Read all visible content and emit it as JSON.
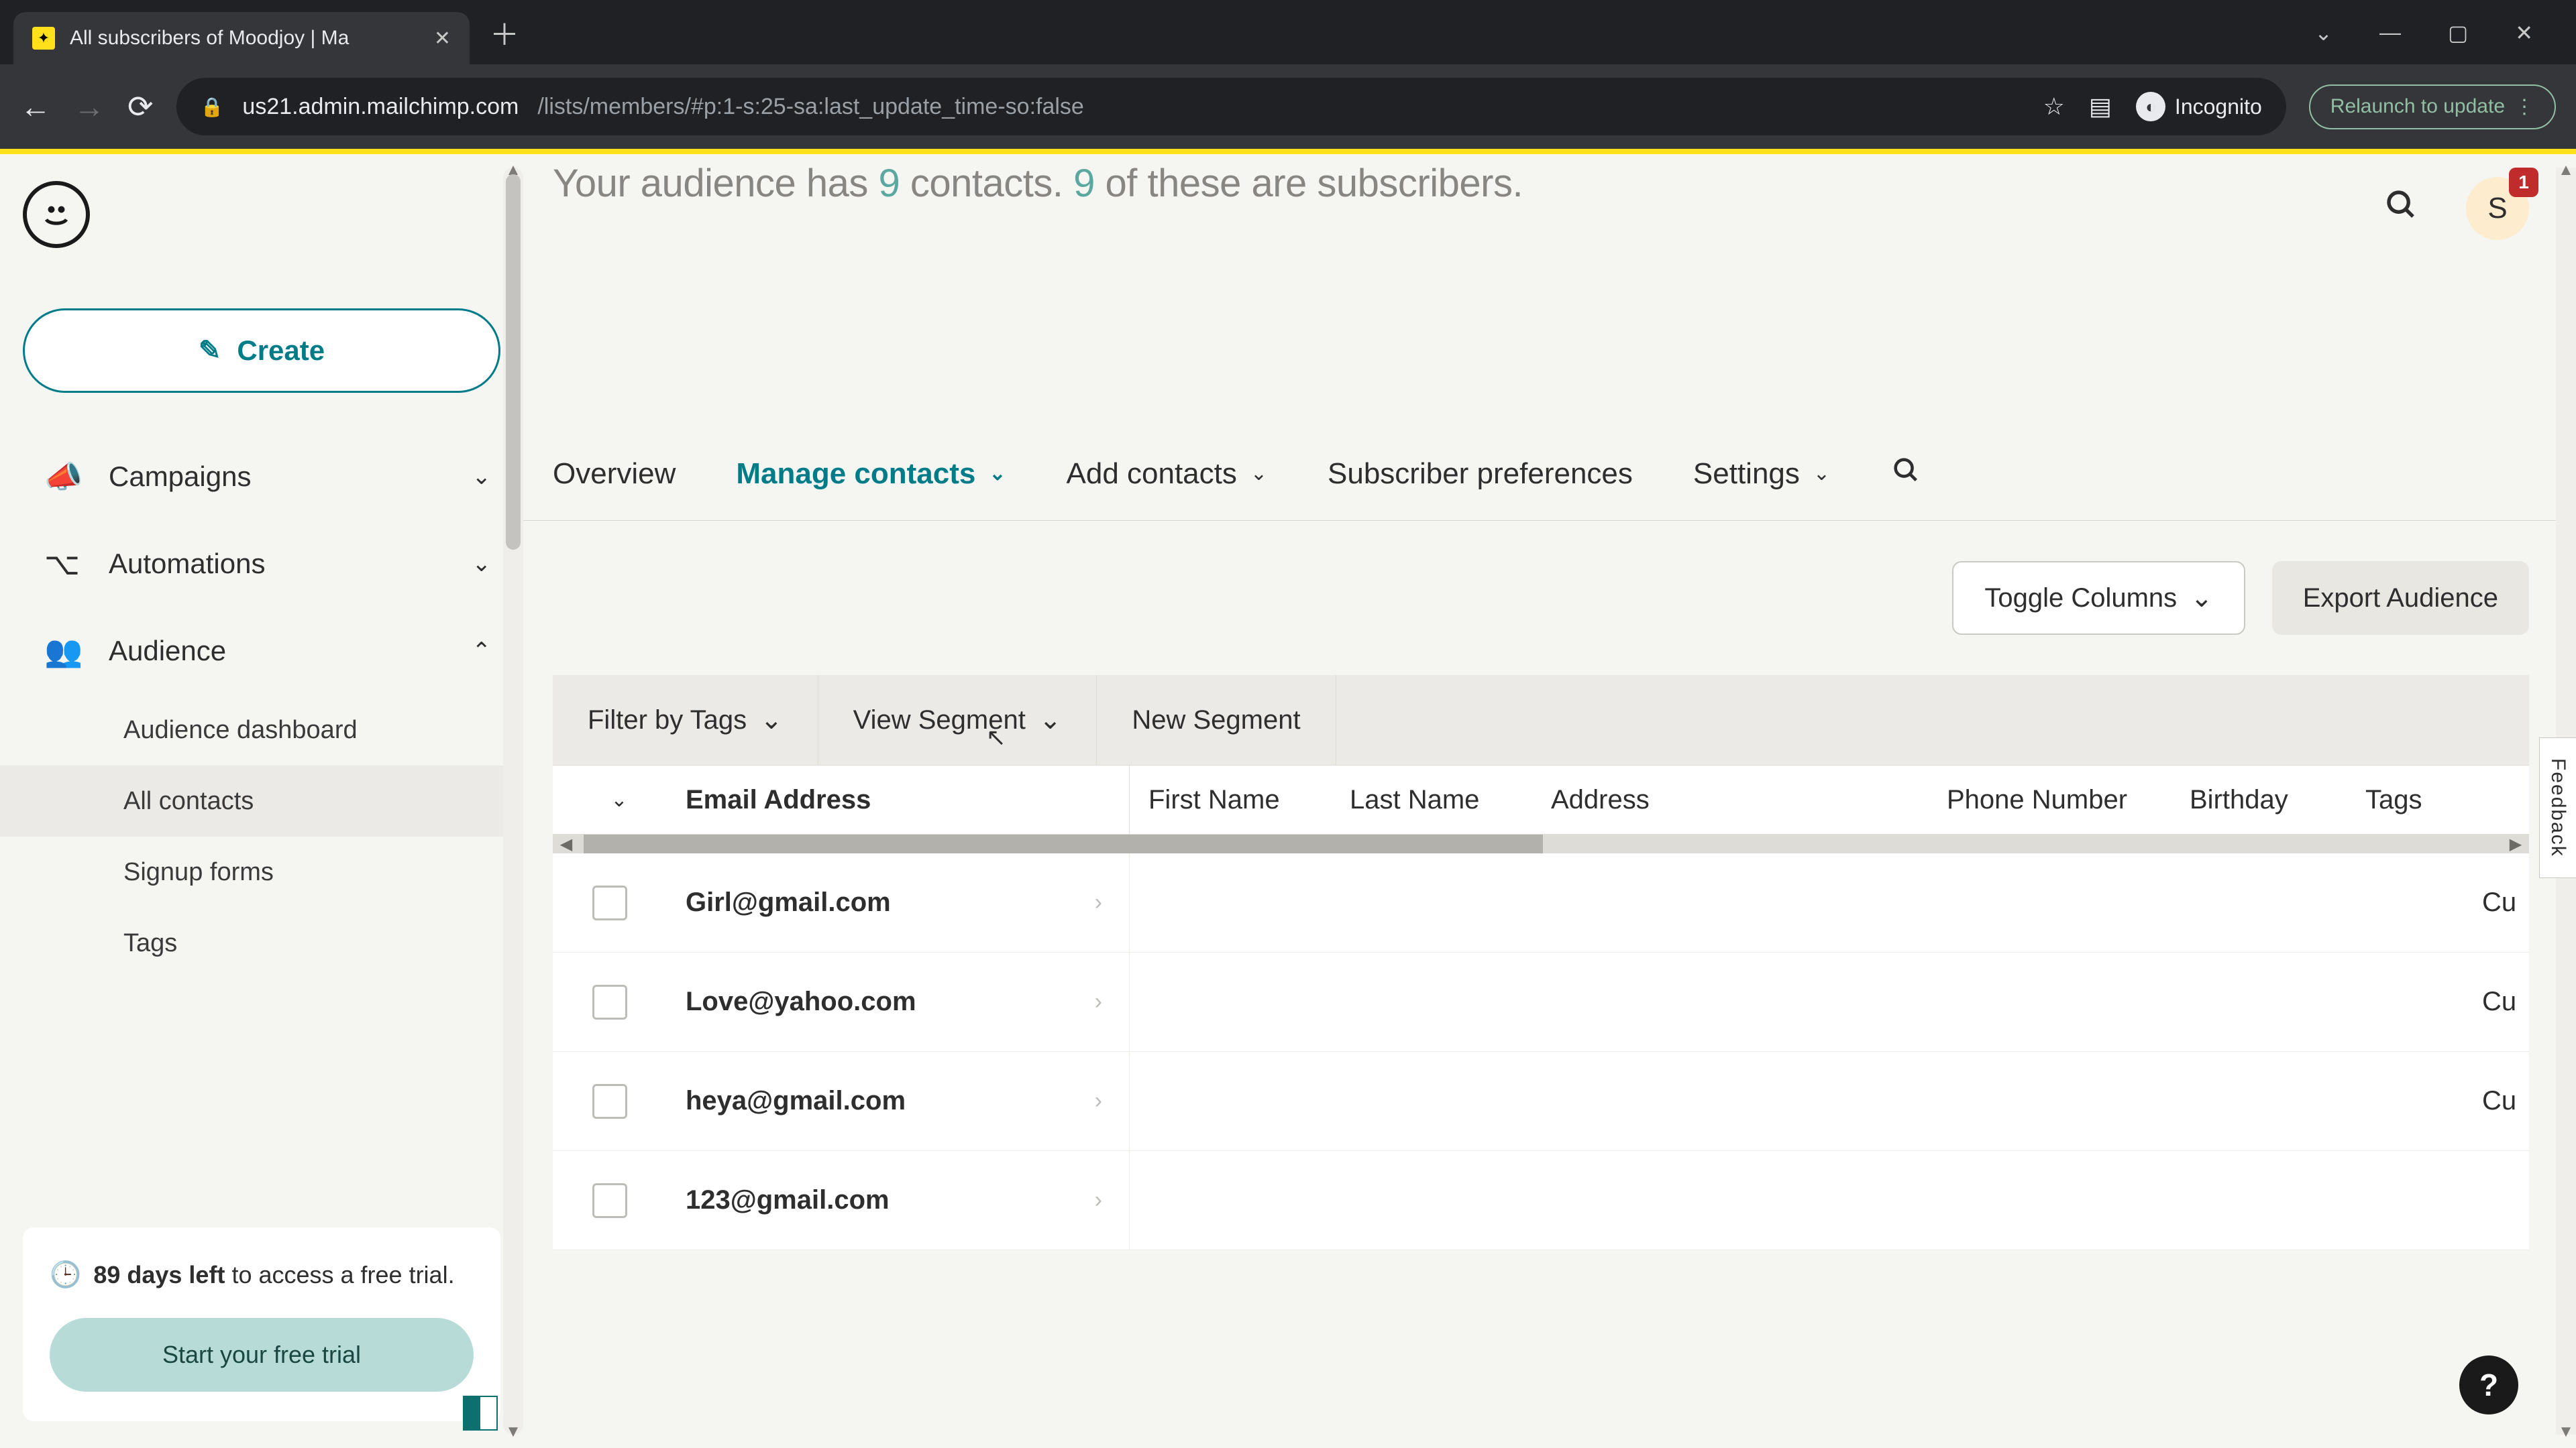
{
  "browser": {
    "tab_title": "All subscribers of Moodjoy | Ma",
    "url_host": "us21.admin.mailchimp.com",
    "url_path": "/lists/members/#p:1-s:25-sa:last_update_time-so:false",
    "incognito_label": "Incognito",
    "relaunch_label": "Relaunch to update"
  },
  "sidebar": {
    "create_label": "Create",
    "items": [
      {
        "label": "Campaigns"
      },
      {
        "label": "Automations"
      },
      {
        "label": "Audience"
      }
    ],
    "audience_sub": [
      {
        "label": "Audience dashboard"
      },
      {
        "label": "All contacts"
      },
      {
        "label": "Signup forms"
      },
      {
        "label": "Tags"
      }
    ],
    "trial_days": "89 days left",
    "trial_rest": " to access a free trial.",
    "trial_btn": "Start your free trial"
  },
  "header": {
    "line_prefix": "Your audience has ",
    "contacts_count": "9",
    "line_mid": " contacts. ",
    "subs_count": "9",
    "line_suffix": " of these are subscribers."
  },
  "tabs": {
    "overview": "Overview",
    "manage": "Manage contacts",
    "add": "Add contacts",
    "prefs": "Subscriber preferences",
    "settings": "Settings"
  },
  "actions": {
    "toggle_cols": "Toggle Columns",
    "export": "Export Audience"
  },
  "filters": {
    "by_tags": "Filter by Tags",
    "view_segment": "View Segment",
    "new_segment": "New Segment"
  },
  "table": {
    "headers": {
      "email": "Email Address",
      "first": "First Name",
      "last": "Last Name",
      "address": "Address",
      "phone": "Phone Number",
      "birthday": "Birthday",
      "tags": "Tags"
    },
    "rows": [
      {
        "email": "Girl@gmail.com",
        "tag_preview": "Cu"
      },
      {
        "email": "Love@yahoo.com",
        "tag_preview": "Cu"
      },
      {
        "email": "heya@gmail.com",
        "tag_preview": "Cu"
      },
      {
        "email": "123@gmail.com",
        "tag_preview": ""
      }
    ]
  },
  "avatar": {
    "initial": "S",
    "badge": "1"
  },
  "feedback_label": "Feedback",
  "help_label": "?"
}
